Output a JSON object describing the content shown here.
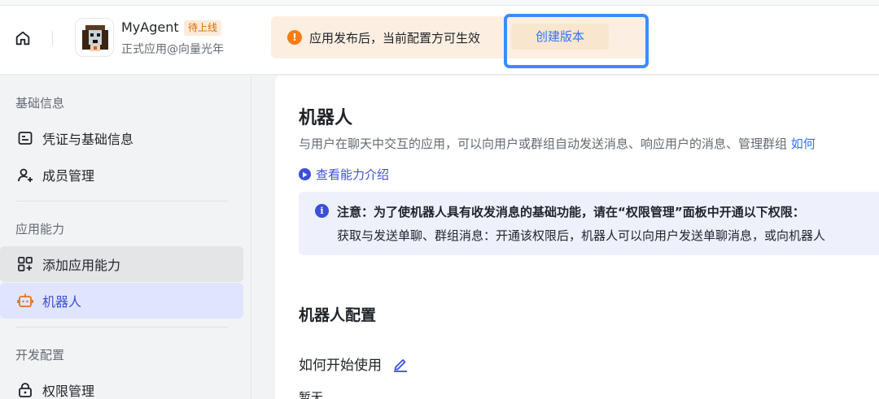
{
  "header": {
    "app_name": "MyAgent",
    "app_status": "待上线",
    "app_subtitle": "正式应用@向量光年",
    "notice_text": "应用发布后，当前配置方可生效",
    "create_version_label": "创建版本",
    "notice_icon": "warning-icon"
  },
  "sidebar": {
    "groups": [
      {
        "title": "基础信息",
        "items": [
          {
            "label": "凭证与基础信息",
            "icon": "credential-icon"
          },
          {
            "label": "成员管理",
            "icon": "add-member-icon"
          }
        ]
      },
      {
        "title": "应用能力",
        "items": [
          {
            "label": "添加应用能力",
            "icon": "add-app-icon"
          },
          {
            "label": "机器人",
            "icon": "robot-icon",
            "active": true
          }
        ]
      },
      {
        "title": "开发配置",
        "items": [
          {
            "label": "权限管理",
            "icon": "lock-icon"
          }
        ]
      }
    ]
  },
  "main": {
    "title": "机器人",
    "description": "与用户在聊天中交互的应用，可以向用户或群组自动发送消息、响应用户的消息、管理群组",
    "description_link": "如何",
    "intro_link": "查看能力介绍",
    "info": {
      "line1": "注意：为了使机器人具有收发消息的基础功能，请在“权限管理”面板中开通以下权限：",
      "line2": "获取与发送单聊、群组消息：开通该权限后，机器人可以向用户发送单聊消息，或向机器人"
    },
    "section_title": "机器人配置",
    "subsection_title": "如何开始使用",
    "empty_text": "暂无"
  },
  "colors": {
    "accent": "#3c4fd7",
    "link": "#3370ff",
    "warning": "#f77c16",
    "highlight": "#3d8bff"
  }
}
